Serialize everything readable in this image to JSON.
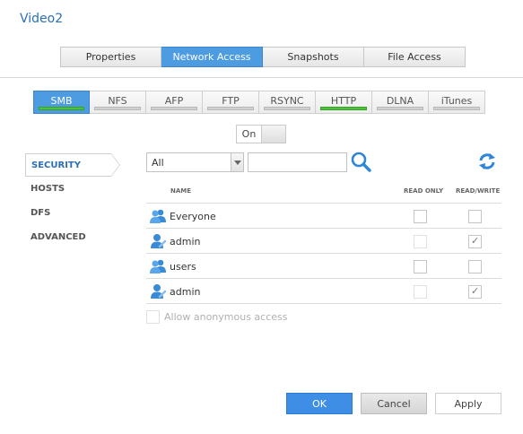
{
  "window": {
    "title": "Video2"
  },
  "tabs": [
    {
      "label": "Properties",
      "active": false
    },
    {
      "label": "Network Access",
      "active": true
    },
    {
      "label": "Snapshots",
      "active": false
    },
    {
      "label": "File Access",
      "active": false
    }
  ],
  "protocols": [
    {
      "label": "SMB",
      "enabled": true,
      "active": true
    },
    {
      "label": "NFS",
      "enabled": false,
      "active": false
    },
    {
      "label": "AFP",
      "enabled": false,
      "active": false
    },
    {
      "label": "FTP",
      "enabled": false,
      "active": false
    },
    {
      "label": "RSYNC",
      "enabled": false,
      "active": false
    },
    {
      "label": "HTTP",
      "enabled": true,
      "active": false
    },
    {
      "label": "DLNA",
      "enabled": false,
      "active": false
    },
    {
      "label": "iTunes",
      "enabled": false,
      "active": false
    }
  ],
  "toggle": {
    "label": "On"
  },
  "sidenav": [
    {
      "label": "SECURITY",
      "active": true
    },
    {
      "label": "HOSTS",
      "active": false
    },
    {
      "label": "DFS",
      "active": false
    },
    {
      "label": "ADVANCED",
      "active": false
    }
  ],
  "filter": {
    "selected": "All",
    "search_value": ""
  },
  "table": {
    "headers": {
      "name": "NAME",
      "read_only": "READ ONLY",
      "read_write": "READ/WRITE"
    },
    "rows": [
      {
        "name": "Everyone",
        "type": "group-icon",
        "read_only": false,
        "read_write": false,
        "ro_disabled": false
      },
      {
        "name": "admin",
        "type": "user-icon",
        "read_only": false,
        "read_write": true,
        "ro_disabled": true
      },
      {
        "name": "users",
        "type": "group-icon",
        "read_only": false,
        "read_write": false,
        "ro_disabled": false
      },
      {
        "name": "admin",
        "type": "user-icon",
        "read_only": false,
        "read_write": true,
        "ro_disabled": true
      }
    ]
  },
  "anonymous": {
    "label": "Allow anonymous access",
    "checked": false
  },
  "buttons": {
    "ok": "OK",
    "cancel": "Cancel",
    "apply": "Apply"
  },
  "colors": {
    "accent": "#4d9be0",
    "enabled_bar": "#4cc23a",
    "title": "#2b6fb6"
  }
}
